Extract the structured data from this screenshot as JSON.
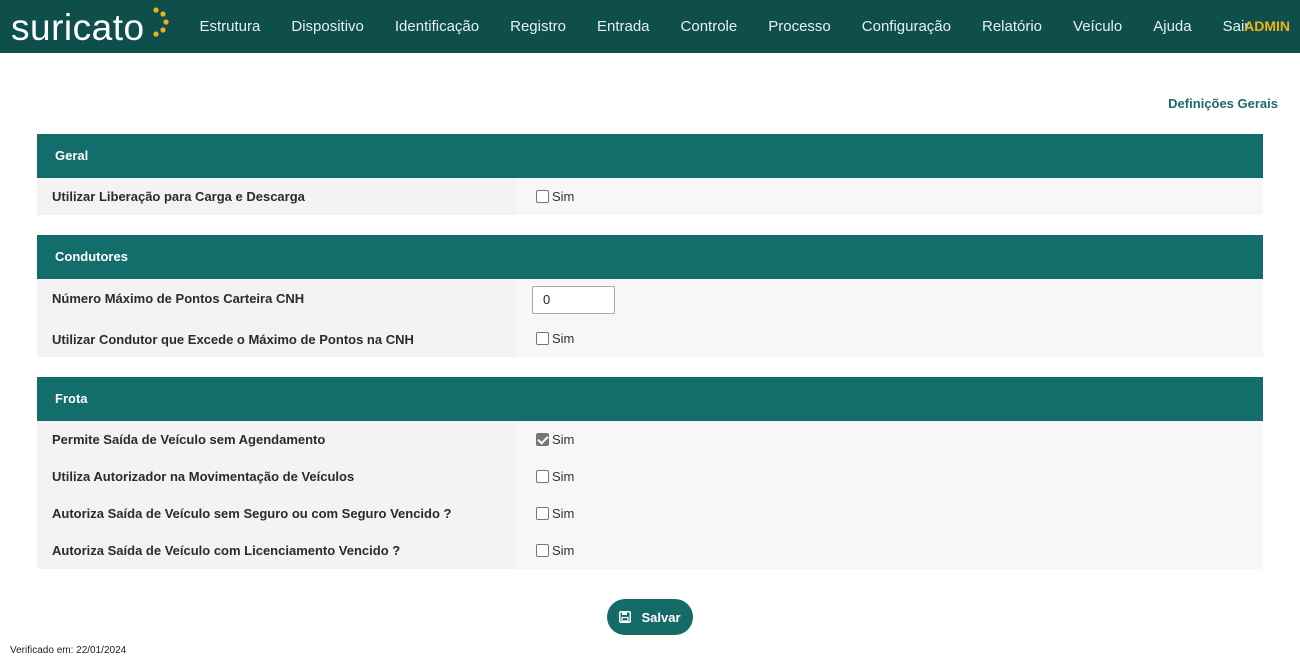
{
  "brand": {
    "logo_text": "suricato",
    "logo_accent_color": "#f2b01e"
  },
  "nav": {
    "items": [
      "Estrutura",
      "Dispositivo",
      "Identificação",
      "Registro",
      "Entrada",
      "Controle",
      "Processo",
      "Configuração",
      "Relatório",
      "Veículo",
      "Ajuda",
      "Sair"
    ],
    "user": "ADMIN"
  },
  "page": {
    "heading": "Definições Gerais"
  },
  "sections": {
    "geral": {
      "title": "Geral",
      "rows": [
        {
          "label": "Utilizar Liberação para Carga e Descarga",
          "option": "Sim",
          "checked": false
        }
      ]
    },
    "condutores": {
      "title": "Condutores",
      "rows": [
        {
          "label": "Número Máximo de Pontos Carteira CNH",
          "value": "0"
        },
        {
          "label": "Utilizar Condutor que Excede o Máximo de Pontos na CNH",
          "option": "Sim",
          "checked": false
        }
      ]
    },
    "frota": {
      "title": "Frota",
      "rows": [
        {
          "label": "Permite Saída de Veículo sem Agendamento",
          "option": "Sim",
          "checked": true
        },
        {
          "label": "Utiliza Autorizador na Movimentação de Veículos",
          "option": "Sim",
          "checked": false
        },
        {
          "label": "Autoriza Saída de Veículo sem Seguro ou com Seguro Vencido ?",
          "option": "Sim",
          "checked": false
        },
        {
          "label": "Autoriza Saída de Veículo com Licenciamento Vencido ?",
          "option": "Sim",
          "checked": false
        }
      ]
    }
  },
  "actions": {
    "save_label": "Salvar"
  },
  "footer": {
    "verified": "Verificado em: 22/01/2024"
  },
  "colors": {
    "navbar": "#0f4f4b",
    "section_header": "#136d6b",
    "accent": "#f2b01e"
  }
}
